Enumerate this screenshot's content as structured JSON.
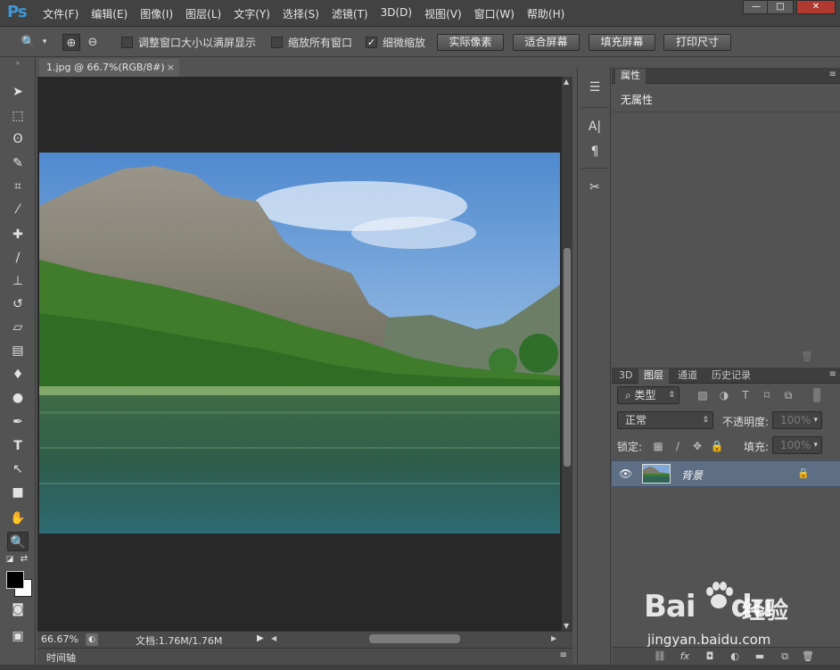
{
  "app": {
    "logo_text": "Ps",
    "menus": [
      "文件(F)",
      "编辑(E)",
      "图像(I)",
      "图层(L)",
      "文字(Y)",
      "选择(S)",
      "滤镜(T)",
      "3D(D)",
      "视图(V)",
      "窗口(W)",
      "帮助(H)"
    ],
    "window_buttons": {
      "minimize": "—",
      "maximize": "□",
      "close": "✕"
    }
  },
  "options_bar": {
    "resize_windows": {
      "label": "调整窗口大小以满屏显示",
      "checked": false
    },
    "zoom_all_windows": {
      "label": "缩放所有窗口",
      "checked": false
    },
    "scrubby_zoom": {
      "label": "细微缩放",
      "checked": true
    },
    "buttons": [
      "实际像素",
      "适合屏幕",
      "填充屏幕",
      "打印尺寸"
    ]
  },
  "document": {
    "tab_title": "1.jpg @ 66.7%(RGB/8#)",
    "close_glyph": "×"
  },
  "status": {
    "zoom": "66.67%",
    "doc_info": "文档:1.76M/1.76M"
  },
  "timeline_label": "时间轴",
  "properties_panel": {
    "tab": "属性",
    "content": "无属性"
  },
  "layers_panel": {
    "tabs": [
      "3D",
      "图层",
      "通道",
      "历史记录"
    ],
    "active_tab": "图层",
    "filter_kind": "类型",
    "blend_mode": "正常",
    "opacity_label": "不透明度:",
    "opacity_value": "100%",
    "lock_label": "锁定:",
    "fill_label": "填充:",
    "fill_value": "100%",
    "layers": [
      {
        "name": "背景",
        "visible": true,
        "locked": true
      }
    ]
  },
  "watermark": {
    "brand": "Bai",
    "brand2": "du",
    "service": "经验",
    "url": "jingyan.baidu.com"
  },
  "colors": {
    "chrome_dark": "#424242",
    "panel": "#535353",
    "canvas_bg": "#282828",
    "selection": "#5d6e85",
    "logo_blue": "#3a98d9"
  },
  "icons": [
    "zoom-tool-icon",
    "zoom-in-icon",
    "zoom-out-icon",
    "move-icon",
    "marquee-icon",
    "lasso-icon",
    "quick-select-icon",
    "crop-icon",
    "eyedropper-icon",
    "healing-icon",
    "brush-icon",
    "stamp-icon",
    "history-brush-icon",
    "eraser-icon",
    "gradient-icon",
    "blur-icon",
    "dodge-icon",
    "pen-icon",
    "type-icon",
    "path-select-icon",
    "rectangle-icon",
    "hand-icon",
    "eye-icon",
    "lock-icon",
    "trash-icon"
  ]
}
